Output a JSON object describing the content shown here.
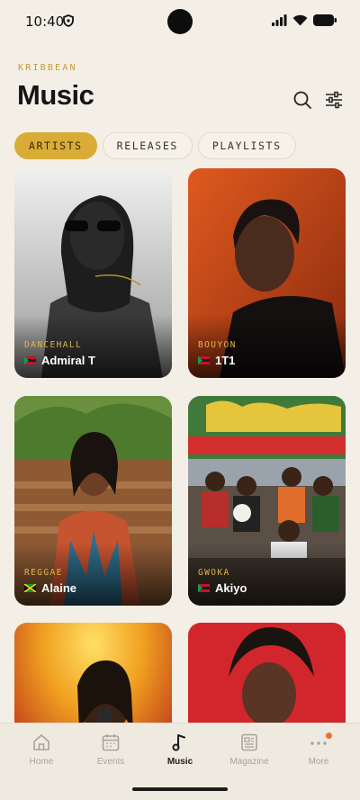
{
  "status": {
    "time": "10:40"
  },
  "header": {
    "brand": "KRIBBEAN",
    "title": "Music"
  },
  "tabs": [
    {
      "label": "ARTISTS",
      "active": true
    },
    {
      "label": "RELEASES",
      "active": false
    },
    {
      "label": "PLAYLISTS",
      "active": false
    }
  ],
  "artists": [
    {
      "genre": "DANCEHALL",
      "name": "Admiral T",
      "flag": "martinique"
    },
    {
      "genre": "BOUYON",
      "name": "1T1",
      "flag": "martinique"
    },
    {
      "genre": "REGGAE",
      "name": "Alaine",
      "flag": "jamaica"
    },
    {
      "genre": "GWOKA",
      "name": "Akiyo",
      "flag": "martinique"
    }
  ],
  "bottom_nav": [
    {
      "label": "Home",
      "icon": "home-icon",
      "active": false
    },
    {
      "label": "Events",
      "icon": "calendar-icon",
      "active": false
    },
    {
      "label": "Music",
      "icon": "music-note-icon",
      "active": true
    },
    {
      "label": "Magazine",
      "icon": "newspaper-icon",
      "active": false
    },
    {
      "label": "More",
      "icon": "more-dots-icon",
      "active": false,
      "badge": true
    }
  ],
  "colors": {
    "accent": "#d9ac38",
    "background": "#f3efe6",
    "genre_text": "#e0b54a",
    "badge": "#e8752a"
  }
}
